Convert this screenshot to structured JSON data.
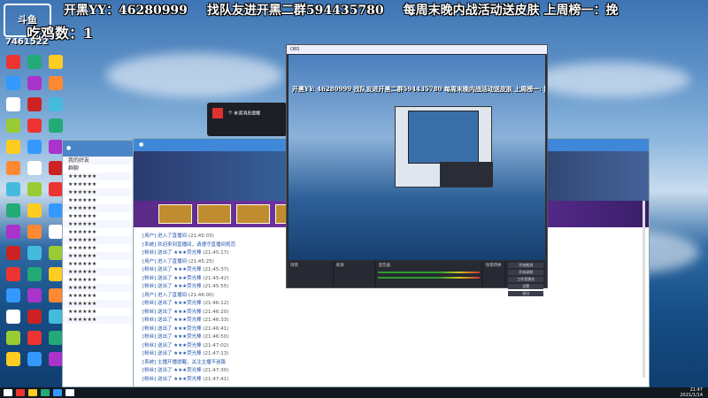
{
  "overlay": {
    "logo_text": "斗鱼",
    "room_id": "7461522",
    "chicken_text": "吃鸡数：1",
    "marquee": [
      "开黑YY：46280999",
      "找队友进开黑二群594435780",
      "每周末晚内战活动送皮肤 上周榜一：挽"
    ]
  },
  "obs": {
    "title": "OBS",
    "marquee": "开黑YY: 46280999   找队友进开黑二群594435780   每周末晚内战活动送皮肤 上周榜一: 挽",
    "docks": [
      "场景",
      "来源",
      "混音器",
      "场景转换",
      "控件"
    ],
    "controls": [
      "开始推流",
      "开始录制",
      "工作室模式",
      "设置",
      "退出"
    ]
  },
  "popup": {
    "text": "个 未读消息提醒"
  },
  "chat_rows": [
    "我的好友",
    "群聊",
    "★★★★★★",
    "★★★★★★",
    "★★★★★★",
    "★★★★★★",
    "★★★★★★",
    "★★★★★★",
    "★★★★★★",
    "★★★★★★",
    "★★★★★★",
    "★★★★★★",
    "★★★★★★",
    "★★★★★★",
    "★★★★★★",
    "★★★★★★",
    "★★★★★★",
    "★★★★★★",
    "★★★★★★",
    "★★★★★★",
    "★★★★★★"
  ],
  "messages": [
    [
      "[用户] 进入了直播间",
      "(21:45:03)"
    ],
    [
      "[系统] 欢迎来到直播间，请遵守直播间规范",
      ""
    ],
    [
      "[粉丝] 送出了 ★★★荧光棒",
      "(21:45:17)"
    ],
    [
      "[用户] 进入了直播间",
      "(21:45:25)"
    ],
    [
      "[粉丝] 送出了 ★★★荧光棒",
      "(21:45:37)"
    ],
    [
      "[粉丝] 送出了 ★★★荧光棒",
      "(21:45:42)"
    ],
    [
      "[粉丝] 送出了 ★★★荧光棒",
      "(21:45:55)"
    ],
    [
      "[用户] 进入了直播间",
      "(21:46:00)"
    ],
    [
      "[粉丝] 送出了 ★★★荧光棒",
      "(21:46:12)"
    ],
    [
      "[粉丝] 送出了 ★★★荧光棒",
      "(21:46:20)"
    ],
    [
      "[粉丝] 送出了 ★★★荧光棒",
      "(21:46:33)"
    ],
    [
      "[粉丝] 送出了 ★★★荧光棒",
      "(21:46:41)"
    ],
    [
      "[粉丝] 送出了 ★★★荧光棒",
      "(21:46:50)"
    ],
    [
      "[粉丝] 送出了 ★★★荧光棒",
      "(21:47:02)"
    ],
    [
      "[粉丝] 送出了 ★★★荧光棒",
      "(21:47:13)"
    ],
    [
      "[系统] 主播开播提醒，关注主播不迷路",
      ""
    ],
    [
      "[粉丝] 送出了 ★★★荧光棒",
      "(21:47:30)"
    ],
    [
      "[粉丝] 送出了 ★★★荧光棒",
      "(21:47:41)"
    ]
  ],
  "taskbar": {
    "time": "21:47",
    "date": "2021/1/14"
  }
}
